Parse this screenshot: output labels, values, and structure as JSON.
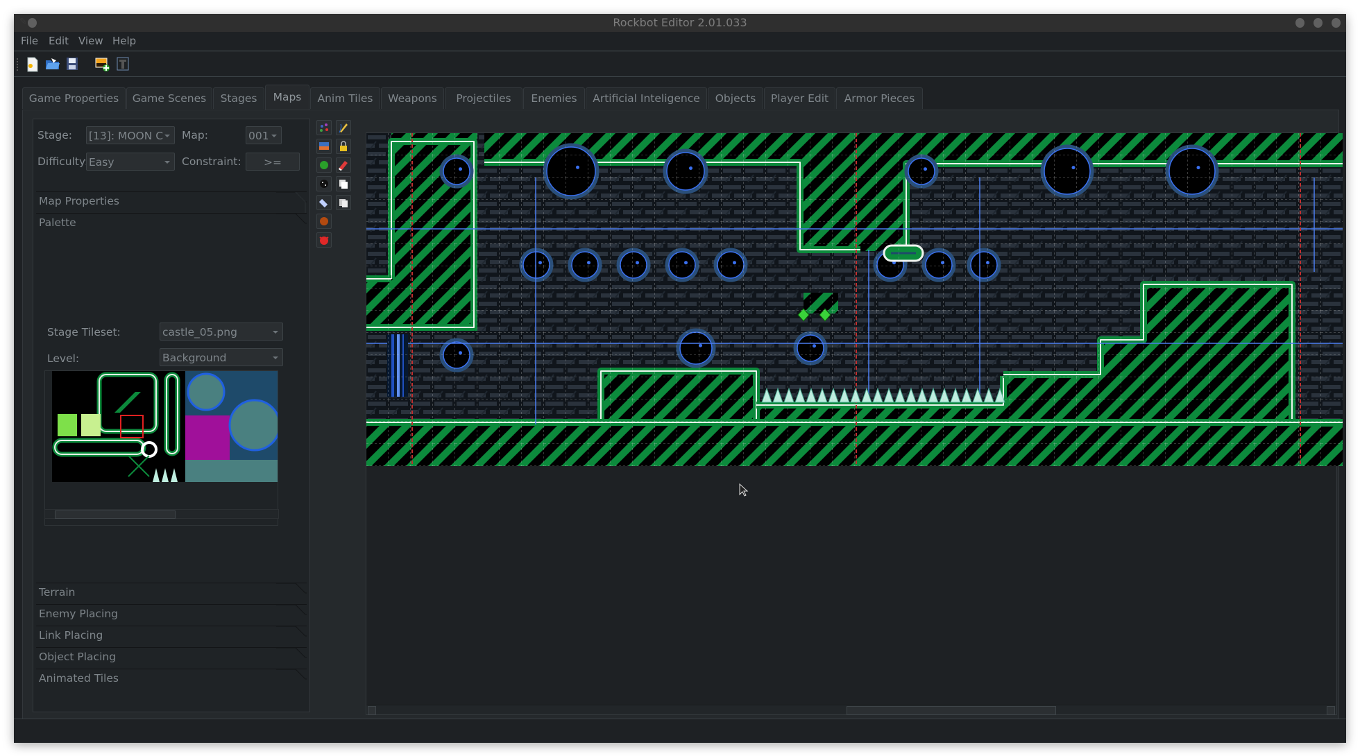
{
  "window": {
    "title": "Rockbot Editor 2.01.033"
  },
  "menu": [
    "File",
    "Edit",
    "View",
    "Help"
  ],
  "toolbar": {
    "icons": [
      "new-file-icon",
      "open-folder-icon",
      "save-icon",
      "add-image-icon",
      "text-tool-icon"
    ]
  },
  "tabs": [
    {
      "label": "Game Properties",
      "active": false
    },
    {
      "label": "Game Scenes",
      "active": false
    },
    {
      "label": "Stages",
      "active": false
    },
    {
      "label": "Maps",
      "active": true
    },
    {
      "label": "Anim Tiles",
      "active": false
    },
    {
      "label": "Weapons",
      "active": false
    },
    {
      "label": "Projectiles",
      "active": false
    },
    {
      "label": "Enemies",
      "active": false
    },
    {
      "label": "Artificial Inteligence",
      "active": false
    },
    {
      "label": "Objects",
      "active": false
    },
    {
      "label": "Player Edit",
      "active": false
    },
    {
      "label": "Armor Pieces",
      "active": false
    }
  ],
  "maps": {
    "stage_label": "Stage:",
    "stage_value": "[13]: MOON C",
    "map_label": "Map:",
    "map_value": "001",
    "difficulty_label": "Difficulty:",
    "difficulty_value": "Easy",
    "constraint_label": "Constraint:",
    "constraint_value": ">=",
    "sections": {
      "map_properties": "Map Properties",
      "palette": "Palette",
      "terrain": "Terrain",
      "enemy_placing": "Enemy Placing",
      "link_placing": "Link Placing",
      "object_placing": "Object Placing",
      "animated_tiles": "Animated Tiles"
    },
    "palette": {
      "stage_tileset_label": "Stage Tileset:",
      "stage_tileset_value": "castle_05.png",
      "level_label": "Level:",
      "level_value": "Background"
    },
    "tools": [
      "palette-icon",
      "pencil-icon",
      "background-image-icon",
      "lock-icon",
      "green-enemy-icon",
      "eraser-icon",
      "dark-object-icon",
      "copy-icon",
      "link-icon",
      "paste-icon",
      "brown-enemy-icon",
      "red-enemy-icon"
    ]
  },
  "colors": {
    "window_bg": "#1e2124",
    "titlebar": "#2f2f2f",
    "map_green": "#0c8a3c",
    "map_blue_line": "#4a7cf0",
    "map_red_line": "#c03030",
    "brick": "#141b22"
  }
}
